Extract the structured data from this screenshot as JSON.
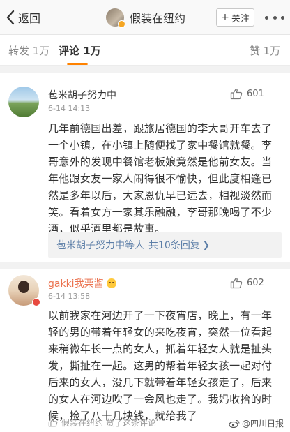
{
  "nav": {
    "back_label": "返回",
    "title": "假装在纽约",
    "follow_label": "关注",
    "follow_plus": "+"
  },
  "tabs": [
    {
      "label": "转发 1万"
    },
    {
      "label": "评论 1万"
    },
    {
      "label": "赞 1万"
    }
  ],
  "comments": [
    {
      "user": "苞米胡子努力中",
      "time": "6-14 14:13",
      "likes": "601",
      "text": "几年前德国出差，跟旅居德国的李大哥开车去了一个小镇，在小镇上随便找了家中餐馆就餐。李哥意外的发现中餐馆老板娘竟然是他前女友。当年他跟女友一家人闹得很不愉快，但此度相逢已然是多年以后，大家恩仇早已远去，相视淡然而笑。看着女方一家其乐融融，李哥那晚喝了不少酒，似乎酒里都是故事。",
      "reply_summary": "苞米胡子努力中等人",
      "reply_count": "共10条回复",
      "reply_chevron": "❯"
    },
    {
      "user": "gakki我栗酱",
      "time": "6-14 13:58",
      "likes": "602",
      "text": "以前我家在河边开了一下夜宵店，晚上，有一年轻的男的带着年轻女的来吃夜宵，突然一位看起来稍微年长一点的女人，抓着年轻女人就是扯头发，撕扯在一起。这男的帮着年轻女孩一起对付后来的女人，没几下就带着年轻女孩走了，后来的女人在河边吹了一会风也走了。我妈收拾的时候，捡了八十几块钱，就给我了",
      "liked_by": "假装在纽约 赞了这条评论"
    }
  ],
  "watermark": "@四川日报",
  "colors": {
    "accent_orange": "#ff8200",
    "link_blue": "#5d7fa8",
    "username_orange": "#eb7350"
  }
}
